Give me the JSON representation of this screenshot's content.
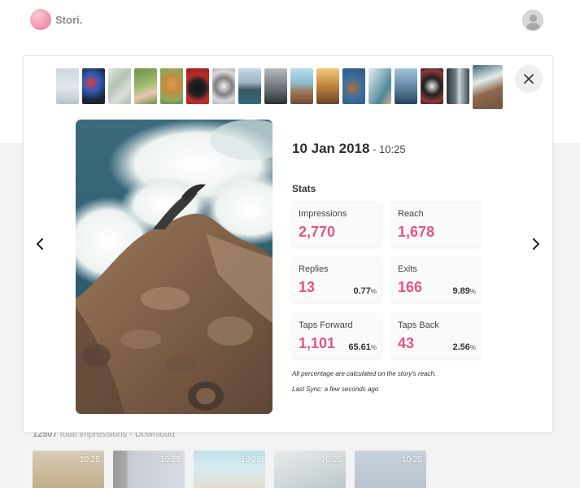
{
  "app": {
    "brand": "Stori.",
    "accent_color": "#e45583"
  },
  "background": {
    "total_impressions": "12507",
    "total_label": " total impressions - ",
    "download_label": "Download",
    "thumbnails": [
      {
        "time": "10:25"
      },
      {
        "time": "10:25"
      },
      {
        "time": "10:25"
      },
      {
        "time": "10:25"
      },
      {
        "time": "10:25"
      }
    ]
  },
  "modal": {
    "thumbnails": [
      {
        "name": "people-beach"
      },
      {
        "name": "colorful-night"
      },
      {
        "name": "tree-branches"
      },
      {
        "name": "hands-leaves"
      },
      {
        "name": "golden-dog"
      },
      {
        "name": "black-dog-red"
      },
      {
        "name": "husky-dog"
      },
      {
        "name": "mountain-lake"
      },
      {
        "name": "misty-mountains"
      },
      {
        "name": "wooden-pier"
      },
      {
        "name": "golden-waves"
      },
      {
        "name": "bird-flight"
      },
      {
        "name": "wave-sand"
      },
      {
        "name": "lake-dock"
      },
      {
        "name": "boston-terrier"
      },
      {
        "name": "doorway-light"
      },
      {
        "name": "ocean-rocks",
        "active": true
      }
    ],
    "date": "10 Jan 2018",
    "time": " - 10:25",
    "stats_title": "Stats",
    "stats": {
      "impressions": {
        "label": "Impressions",
        "value": "2,770"
      },
      "reach": {
        "label": "Reach",
        "value": "1,678"
      },
      "replies": {
        "label": "Replies",
        "value": "13",
        "pct": "0.77",
        "pct_sign": "%"
      },
      "exits": {
        "label": "Exits",
        "value": "166",
        "pct": "9.89",
        "pct_sign": "%"
      },
      "taps_forward": {
        "label": "Taps Forward",
        "value": "1,101",
        "pct": "65.61",
        "pct_sign": "%"
      },
      "taps_back": {
        "label": "Taps Back",
        "value": "43",
        "pct": "2.56",
        "pct_sign": "%"
      }
    },
    "note_percentage": "All percentage are calculated on the story's reach.",
    "note_sync": "Last Sync: a few seconds ago"
  }
}
